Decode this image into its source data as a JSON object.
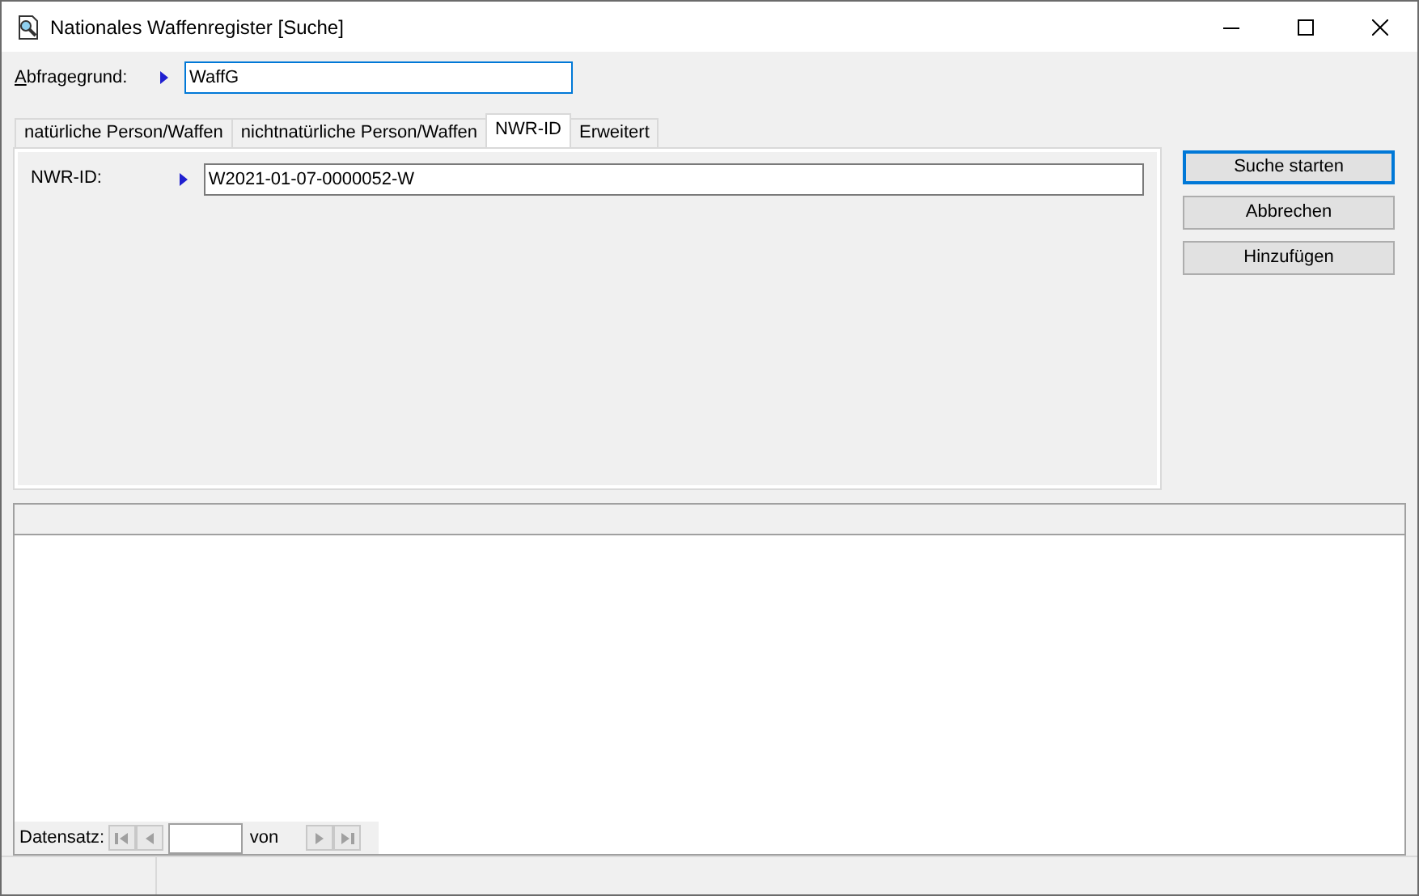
{
  "window": {
    "title": "Nationales Waffenregister [Suche]"
  },
  "query": {
    "label": "Abfragegrund:",
    "value": "WaffG"
  },
  "tabs": [
    {
      "label": "natürliche Person/Waffen",
      "selected": false
    },
    {
      "label": "nichtnatürliche Person/Waffen",
      "selected": false
    },
    {
      "label": "NWR-ID",
      "selected": true
    },
    {
      "label": "Erweitert",
      "selected": false
    }
  ],
  "fields": [
    {
      "label": "NWR-ID:",
      "value": "W2021-01-07-0000052-W"
    }
  ],
  "buttons": [
    {
      "label": "Suche starten",
      "default": true
    },
    {
      "label": "Abbrechen",
      "default": false
    },
    {
      "label": "Hinzufügen",
      "default": false
    }
  ],
  "navigator": {
    "label": "Datensatz:",
    "of_label": "von"
  }
}
